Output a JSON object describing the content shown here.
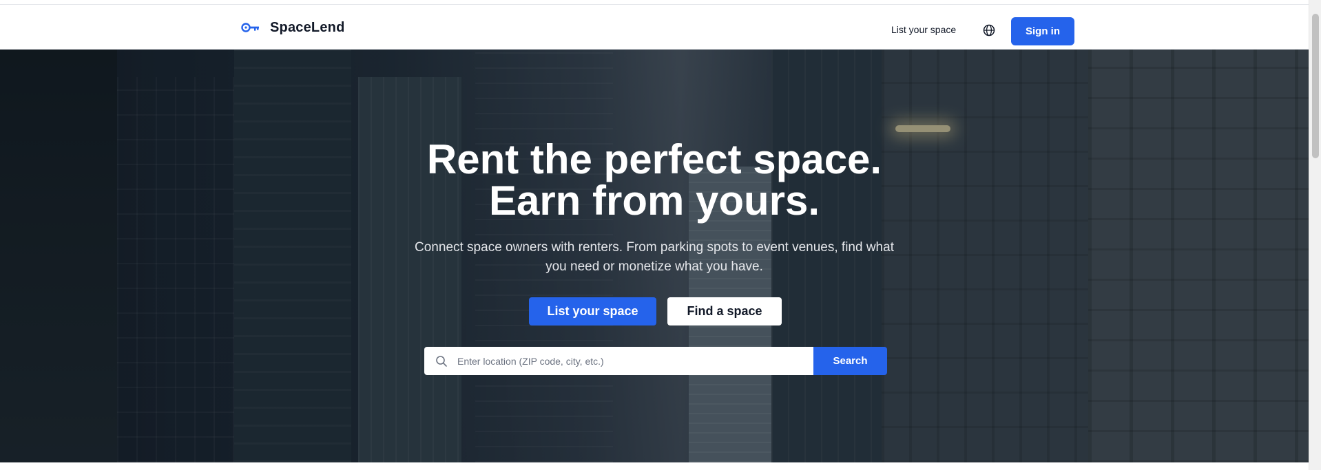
{
  "brand": {
    "name": "SpaceLend",
    "icon": "key-icon",
    "accent": "#2563eb"
  },
  "header": {
    "nav_list_space": "List your space",
    "language_icon": "globe-icon",
    "sign_in": "Sign in"
  },
  "hero": {
    "headline_line1": "Rent the perfect space.",
    "headline_line2": "Earn from yours.",
    "subtext": "Connect space owners with renters. From parking spots to event venues, find what you need or monetize what you have.",
    "primary_cta": "List your space",
    "secondary_cta": "Find a space",
    "search": {
      "placeholder": "Enter location (ZIP code, city, etc.)",
      "value": "",
      "button": "Search",
      "icon": "search-icon"
    }
  }
}
